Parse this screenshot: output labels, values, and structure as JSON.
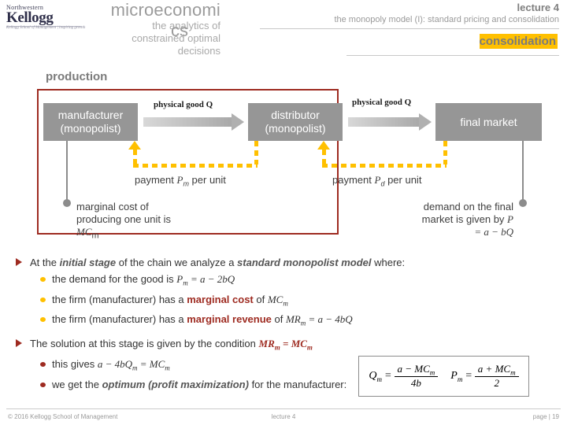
{
  "logo": {
    "university": "Northwestern",
    "school": "Kellogg",
    "tagline": "Kellogg School of Management | inspiring growth"
  },
  "header": {
    "course_title": "microeconomi",
    "course_title_wrap": "cs",
    "course_subtitle_line1": "the analytics of",
    "course_subtitle_line2": "constrained optimal",
    "course_subtitle_line3": "decisions",
    "lecture_number": "lecture 4",
    "lecture_subtitle": "the monopoly model (I): standard pricing and consolidation",
    "section_title": "consolidation"
  },
  "diagram": {
    "section_label": "production",
    "nodes": [
      {
        "id": "manufacturer",
        "line1": "manufacturer",
        "line2": "(monopolist)"
      },
      {
        "id": "distributor",
        "line1": "distributor",
        "line2": "(monopolist)"
      },
      {
        "id": "final-market",
        "line1": "final market",
        "line2": ""
      }
    ],
    "flow_label_1": "physical good Q",
    "flow_label_2": "physical good Q",
    "payment_label_1_prefix": "payment ",
    "payment_label_1_symbol": "P",
    "payment_label_1_sub": "m",
    "payment_label_1_suffix": " per unit",
    "payment_label_2_prefix": "payment ",
    "payment_label_2_symbol": "P",
    "payment_label_2_sub": "d",
    "payment_label_2_suffix": " per unit",
    "callout_left_line1": "marginal cost of",
    "callout_left_line2": "producing one unit is",
    "callout_left_math": "MC",
    "callout_left_math_sub": "m",
    "callout_right_line1": "demand on the final",
    "callout_right_line2": "market is given by ",
    "callout_right_math1": "P",
    "callout_right_math2": " = a − bQ",
    "colors": {
      "frame_red": "#9e2b21",
      "node_gray": "#969696",
      "payment_yellow": "#ffc000",
      "callout_gray": "#8c8c8c"
    }
  },
  "body": {
    "bullet1": {
      "text_a": "At the ",
      "em_a": "initial stage",
      "text_b": " of the chain we analyze a ",
      "em_b": "standard monopolist model",
      "text_c": " where:"
    },
    "sub1_1": {
      "text_a": "the demand for the good is ",
      "math": "P",
      "math_sub": "m",
      "math_b": " = a − 2bQ"
    },
    "sub1_2": {
      "text_a": "the firm (manufacturer) has a ",
      "em": "marginal cost",
      "text_b": " of ",
      "math": "MC",
      "math_sub": "m"
    },
    "sub1_3": {
      "text_a": "the firm (manufacturer) has a ",
      "em": "marginal revenue",
      "text_b": " of ",
      "math": "MR",
      "math_sub": "m",
      "math_b": " = a − 4bQ"
    },
    "bullet2": {
      "text_a": "The solution at this stage is given by the condition  ",
      "math1": "MR",
      "math1_sub": "m",
      "eq": " = ",
      "math2": "MC",
      "math2_sub": "m"
    },
    "sub2_1": {
      "text_a": "this gives  ",
      "math": "a − 4bQ",
      "math_sub": "m",
      "math_b": " = MC",
      "math_b_sub": "m"
    },
    "sub2_2": {
      "text_a": "we get the ",
      "em": "optimum (profit maximization)",
      "text_b": " for the manufacturer:"
    }
  },
  "formula": {
    "q_lhs": "Q",
    "q_lhs_sub": "m",
    "q_eq": "=",
    "q_num": "a − MC",
    "q_num_sub": "m",
    "q_den": "4b",
    "p_lhs": "P",
    "p_lhs_sub": "m",
    "p_eq": "=",
    "p_num": "a + MC",
    "p_num_sub": "m",
    "p_den": "2"
  },
  "footer": {
    "left": "© 2016 Kellogg School of Management",
    "center": "lecture 4",
    "right": "page | 19"
  }
}
